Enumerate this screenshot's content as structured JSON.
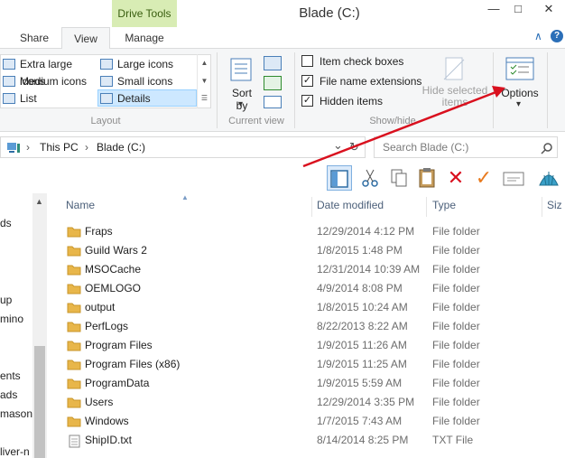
{
  "window": {
    "title": "Blade (C:)",
    "context_tab_group": "Drive Tools",
    "minimize": "—",
    "maximize": "□",
    "close": "✕"
  },
  "ribbon_tabs": [
    {
      "label": "Share"
    },
    {
      "label": "View"
    },
    {
      "label": "Manage"
    }
  ],
  "ribbon_controls": {
    "collapse": "∧",
    "help": "?"
  },
  "layout_group": {
    "label": "Layout",
    "items": [
      {
        "label": "Extra large icons"
      },
      {
        "label": "Large icons"
      },
      {
        "label": "Medium icons"
      },
      {
        "label": "Small icons"
      },
      {
        "label": "List"
      },
      {
        "label": "Details"
      }
    ]
  },
  "current_view_group": {
    "label": "Current view",
    "sort_by": "Sort by",
    "sort_by_arrow": "▾"
  },
  "show_hide_group": {
    "label": "Show/hide",
    "checkboxes": [
      {
        "label": "Item check boxes",
        "checked": false
      },
      {
        "label": "File name extensions",
        "checked": true
      },
      {
        "label": "Hidden items",
        "checked": true
      }
    ],
    "hide_selected": "Hide selected items",
    "check_mark": "✓"
  },
  "options": {
    "label": "Options",
    "arrow": "▾"
  },
  "address_bar": {
    "breadcrumb": [
      "This PC",
      "Blade (C:)"
    ],
    "separator": "›",
    "dropdown": "⌄",
    "refresh": "↻"
  },
  "search": {
    "placeholder": "Search Blade (C:)"
  },
  "nav_pane": {
    "items": [
      {
        "label": "ds"
      },
      {
        "label": "up"
      },
      {
        "label": "mino"
      },
      {
        "label": "ents"
      },
      {
        "label": "ads"
      },
      {
        "label": "mason"
      },
      {
        "label": "liver-n"
      }
    ]
  },
  "columns": {
    "name": "Name",
    "date": "Date modified",
    "type": "Type",
    "size": "Siz"
  },
  "files": [
    {
      "name": "Fraps",
      "date": "12/29/2014 4:12 PM",
      "type": "File folder",
      "kind": "folder"
    },
    {
      "name": "Guild Wars 2",
      "date": "1/8/2015 1:48 PM",
      "type": "File folder",
      "kind": "folder"
    },
    {
      "name": "MSOCache",
      "date": "12/31/2014 10:39 AM",
      "type": "File folder",
      "kind": "folder"
    },
    {
      "name": "OEMLOGO",
      "date": "4/9/2014 8:08 PM",
      "type": "File folder",
      "kind": "folder"
    },
    {
      "name": "output",
      "date": "1/8/2015 10:24 AM",
      "type": "File folder",
      "kind": "folder"
    },
    {
      "name": "PerfLogs",
      "date": "8/22/2013 8:22 AM",
      "type": "File folder",
      "kind": "folder"
    },
    {
      "name": "Program Files",
      "date": "1/9/2015 11:26 AM",
      "type": "File folder",
      "kind": "folder"
    },
    {
      "name": "Program Files (x86)",
      "date": "1/9/2015 11:25 AM",
      "type": "File folder",
      "kind": "folder"
    },
    {
      "name": "ProgramData",
      "date": "1/9/2015 5:59 AM",
      "type": "File folder",
      "kind": "folder"
    },
    {
      "name": "Users",
      "date": "12/29/2014 3:35 PM",
      "type": "File folder",
      "kind": "folder"
    },
    {
      "name": "Windows",
      "date": "1/7/2015 7:43 AM",
      "type": "File folder",
      "kind": "folder"
    },
    {
      "name": "ShipID.txt",
      "date": "8/14/2014 8:25 PM",
      "type": "TXT File",
      "kind": "text"
    }
  ],
  "colors": {
    "annotation_arrow": "#d9101e",
    "folder": "#e8b64a",
    "selection": "#cde8ff",
    "context_tab": "#d8ecb4"
  }
}
